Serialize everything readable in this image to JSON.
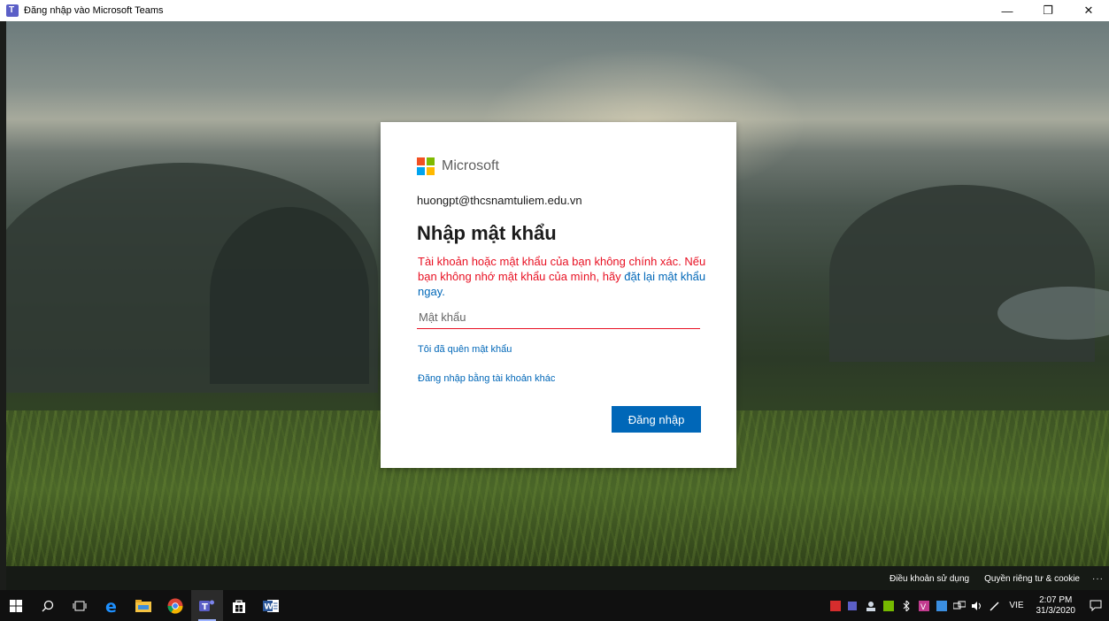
{
  "window": {
    "title": "Đăng nhập vào Microsoft Teams",
    "minimize": "—",
    "restore": "❐",
    "close": "✕"
  },
  "card": {
    "brand": "Microsoft",
    "brand_colors": [
      "#f25022",
      "#7fba00",
      "#00a4ef",
      "#ffb900"
    ],
    "email": "huongpt@thcsnamtuliem.edu.vn",
    "heading": "Nhập mật khẩu",
    "error_text": "Tài khoản hoặc mật khẩu của bạn không chính xác. Nếu bạn không nhớ mật khẩu của mình, hãy ",
    "error_link": "đặt lại mật khẩu ngay.",
    "password_placeholder": "Mật khẩu",
    "forgot_link": "Tôi đã quên mật khẩu",
    "other_account_link": "Đăng nhập bằng tài khoản khác",
    "signin_button": "Đăng nhập"
  },
  "footer": {
    "terms": "Điều khoản sử dụng",
    "privacy": "Quyền riêng tư & cookie",
    "more": "···"
  },
  "taskbar": {
    "apps": [
      "windows-start-icon",
      "search-icon",
      "task-view-icon",
      "edge-icon",
      "file-explorer-icon",
      "chrome-icon",
      "teams-icon",
      "store-icon",
      "word-icon"
    ],
    "language": "VIE",
    "time": "2:07 PM",
    "date": "31/3/2020"
  },
  "colors": {
    "accent": "#0067b8",
    "error": "#e81123"
  }
}
